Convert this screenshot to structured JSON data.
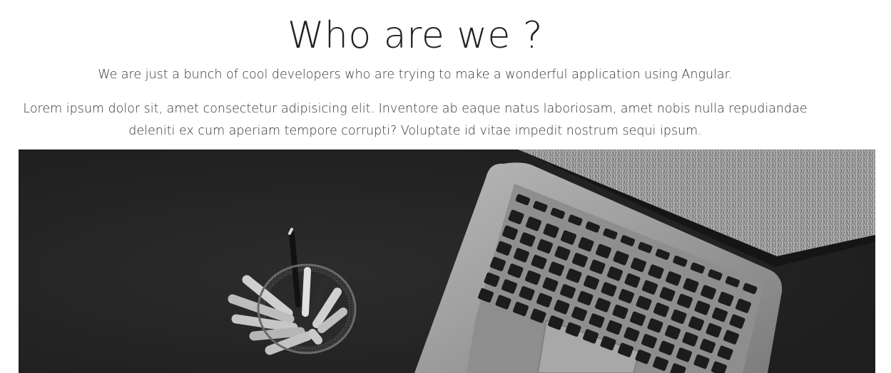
{
  "section": {
    "title": "Who are we ?",
    "subtitle": "We are just a bunch of cool developers who are trying to make a wonderful application using Angular.",
    "paragraph": "Lorem ipsum dolor sit, amet consectetur adipisicing elit. Inventore ab eaque natus laboriosam, amet nobis nulla repudiandae deleniti ex cum aperiam tempore corrupti? Voluptate id vitae impedit nostrum sequi ipsum."
  },
  "image": {
    "description_icon": "laptop-and-pencil-cup-photo-icon"
  },
  "colors": {
    "background": "#ffffff",
    "text": "#333333",
    "photo_dark": "#242424",
    "laptop_silver": "#9a9a9a",
    "keys": "#1c1c1c"
  }
}
